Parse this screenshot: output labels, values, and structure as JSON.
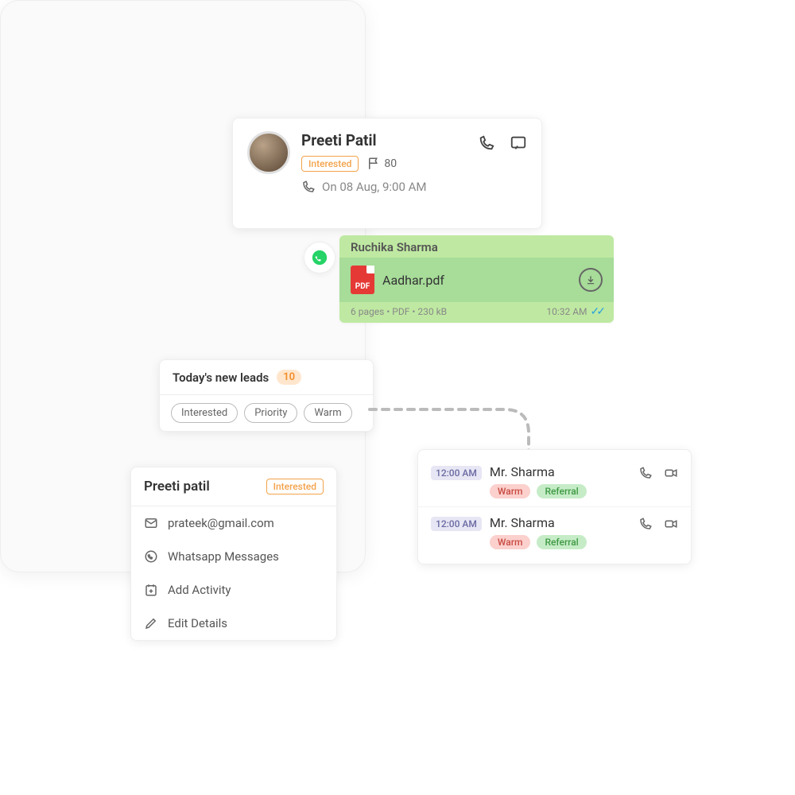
{
  "contact": {
    "name": "Preeti Patil",
    "tag": "Interested",
    "score": "80",
    "call_info": "On 08 Aug, 9:00 AM"
  },
  "whatsapp": {
    "sender": "Ruchika Sharma",
    "filename": "Aadhar.pdf",
    "meta": "6 pages • PDF  • 230 kB",
    "time": "10:32 AM"
  },
  "leads": {
    "title": "Today's new leads",
    "count": "10",
    "chips": {
      "a": "Interested",
      "b": "Priority",
      "c": "Warm"
    }
  },
  "lead_rows": {
    "r1": {
      "time": "12:00 AM",
      "name": "Mr. Sharma",
      "tag1": "Warm",
      "tag2": "Referral"
    },
    "r2": {
      "time": "12:00 AM",
      "name": "Mr. Sharma",
      "tag1": "Warm",
      "tag2": "Referral"
    }
  },
  "detail": {
    "name": "Preeti patil",
    "tag": "Interested",
    "email": "prateek@gmail.com",
    "item2": "Whatsapp Messages",
    "item3": "Add Activity",
    "item4": "Edit Details"
  }
}
